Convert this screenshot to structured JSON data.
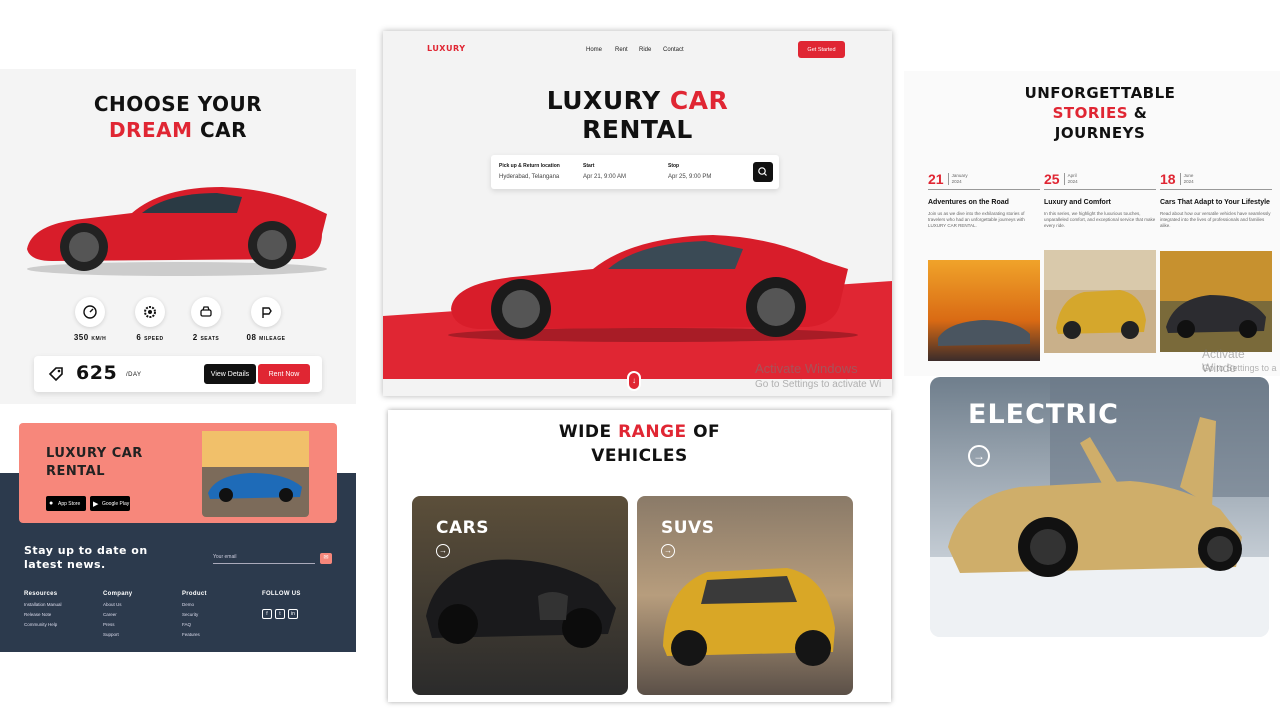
{
  "choose": {
    "title_line1": "CHOOSE YOUR",
    "title_accent": "DREAM",
    "title_rest": "CAR",
    "specs": [
      {
        "icon": "speedometer-icon",
        "value": "350",
        "unit": "KM/H"
      },
      {
        "icon": "gear-icon",
        "value": "6",
        "unit": "SPEED"
      },
      {
        "icon": "car-icon",
        "value": "2",
        "unit": "SEATS"
      },
      {
        "icon": "mileage-icon",
        "value": "08",
        "unit": "MILEAGE"
      }
    ],
    "price": "625",
    "price_unit": "/DAY",
    "view_details": "View Details",
    "rent_now": "Rent Now"
  },
  "hero": {
    "logo": "LUXURY",
    "nav": [
      "Home",
      "Rent",
      "Ride",
      "Contact"
    ],
    "cta": "Get Started",
    "title_line1_a": "LUXURY",
    "title_line1_b": "CAR",
    "title_line2": "RENTAL",
    "search": {
      "location_label": "Pick up & Return location",
      "location_value": "Hyderabad, Telangana",
      "start_label": "Start",
      "start_value": "Apr 21, 9:00 AM",
      "stop_label": "Stop",
      "stop_value": "Apr 25, 9:00 PM"
    },
    "watermark_title": "Activate Windows",
    "watermark_sub": "Go to Settings to activate Wi"
  },
  "stories": {
    "title_line1": "UNFORGETTABLE",
    "title_accent": "STORIES",
    "title_amp": "&",
    "title_line3": "JOURNEYS",
    "items": [
      {
        "day": "21",
        "month": "January",
        "year": "2024",
        "heading": "Adventures on the Road",
        "text": "Join us as we dive into the exhilarating stories of travelers who had an unforgettable journeys with LUXURY CAR RENTAL."
      },
      {
        "day": "25",
        "month": "April",
        "year": "2024",
        "heading": "Luxury and Comfort",
        "text": "In this series, we highlight the luxurious touches, unparalleled comfort, and exceptional service that make every ride."
      },
      {
        "day": "18",
        "month": "June",
        "year": "2024",
        "heading": "Cars That Adapt to Your Lifestyle",
        "text": "Read about how our versatile vehicles have seamlessly integrated into the lives of professionals and families alike."
      }
    ],
    "watermark_title": "Activate Windo",
    "watermark_sub": "Go to Settings to a"
  },
  "footer": {
    "promo_title_1": "LUXURY CAR",
    "promo_title_2": "RENTAL",
    "app_store": "App Store",
    "google_play": "Google Play",
    "newsletter_1": "Stay up to date on",
    "newsletter_2": "latest news.",
    "email_placeholder": "Your email",
    "columns": [
      {
        "heading": "Resources",
        "items": [
          "Installation Manual",
          "Release Note",
          "Community Help"
        ]
      },
      {
        "heading": "Company",
        "items": [
          "About Us",
          "Career",
          "Press",
          "Support"
        ]
      },
      {
        "heading": "Product",
        "items": [
          "Demo",
          "Security",
          "FAQ",
          "Features"
        ]
      }
    ],
    "follow": "FOLLOW US"
  },
  "range": {
    "title_a": "WIDE",
    "title_accent": "RANGE",
    "title_b": "OF",
    "title_line2": "VEHICLES",
    "cards": [
      "CARS",
      "SUVS"
    ]
  },
  "electric": {
    "title": "ELECTRIC"
  },
  "colors": {
    "accent": "#e02633",
    "navy": "#2c3a4d",
    "salmon": "#f7877b"
  }
}
